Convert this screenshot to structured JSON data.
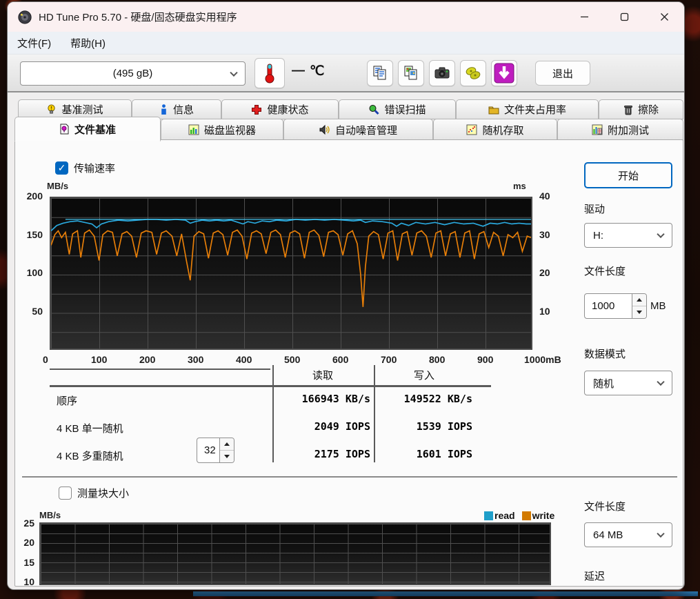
{
  "window": {
    "title": "HD Tune Pro 5.70 - 硬盘/固态硬盘实用程序"
  },
  "menu": {
    "file": "文件(F)",
    "help": "帮助(H)"
  },
  "toolbar": {
    "drive_value": "(495 gB)",
    "temp_value": "—",
    "temp_unit": "℃",
    "exit_label": "退出"
  },
  "tabs": {
    "row1": [
      "基准测试",
      "信息",
      "健康状态",
      "错误扫描",
      "文件夹占用率",
      "擦除"
    ],
    "row2": [
      "文件基准",
      "磁盘监视器",
      "自动噪音管理",
      "随机存取",
      "附加测试"
    ],
    "selected": "文件基准"
  },
  "benchmark": {
    "transfer_rate_label": "传输速率",
    "start_label": "开始",
    "drive_label": "驱动",
    "drive_value": "H:",
    "file_length_label": "文件长度",
    "file_length_value": "1000",
    "file_length_unit": "MB",
    "data_mode_label": "数据模式",
    "data_mode_value": "随机"
  },
  "results_table": {
    "col_read": "读取",
    "col_write": "写入",
    "rows": [
      {
        "label": "顺序",
        "read": "166943 KB/s",
        "write": "149522 KB/s"
      },
      {
        "label": "4 KB 单一随机",
        "read": "2049 IOPS",
        "write": "1539 IOPS"
      },
      {
        "label": "4 KB 多重随机",
        "queue_depth": "32",
        "read": "2175 IOPS",
        "write": "1601 IOPS"
      }
    ]
  },
  "block_section": {
    "checkbox_label": "测量块大小",
    "file_length_label": "文件长度",
    "file_length_value": "64 MB",
    "latency_label": "延迟"
  },
  "chart_data": [
    {
      "id": "transfer-rate",
      "type": "line",
      "title": "传输速率",
      "ylabel_left": "MB/s",
      "ylabel_right": "ms",
      "xlim": [
        0,
        1000
      ],
      "ylim_left": [
        0,
        200
      ],
      "ylim_right": [
        0,
        40
      ],
      "grid": true,
      "xticks": [
        "0",
        "100",
        "200",
        "300",
        "400",
        "500",
        "600",
        "700",
        "800",
        "900",
        "1000mB"
      ],
      "yticks_left": [
        200,
        150,
        100,
        50
      ],
      "yticks_right": [
        40,
        30,
        20,
        10
      ],
      "series": [
        {
          "name": "read",
          "color": "#2aa9de",
          "points": [
            [
              0,
              157
            ],
            [
              12,
              164
            ],
            [
              25,
              167
            ],
            [
              40,
              169
            ],
            [
              55,
              170
            ],
            [
              70,
              168
            ],
            [
              85,
              166
            ],
            [
              95,
              161
            ],
            [
              105,
              166
            ],
            [
              120,
              169
            ],
            [
              140,
              171
            ],
            [
              160,
              170
            ],
            [
              180,
              171
            ],
            [
              200,
              172
            ],
            [
              220,
              172
            ],
            [
              240,
              171
            ],
            [
              260,
              172
            ],
            [
              280,
              171
            ],
            [
              290,
              167
            ],
            [
              300,
              169
            ],
            [
              315,
              171
            ],
            [
              330,
              170
            ],
            [
              345,
              171
            ],
            [
              360,
              170
            ],
            [
              375,
              171
            ],
            [
              390,
              168
            ],
            [
              400,
              166
            ],
            [
              410,
              169
            ],
            [
              425,
              167
            ],
            [
              440,
              170
            ],
            [
              455,
              169
            ],
            [
              470,
              171
            ],
            [
              490,
              170
            ],
            [
              510,
              172
            ],
            [
              530,
              171
            ],
            [
              550,
              172
            ],
            [
              570,
              171
            ],
            [
              590,
              172
            ],
            [
              610,
              171
            ],
            [
              630,
              170
            ],
            [
              645,
              171
            ],
            [
              655,
              168
            ],
            [
              670,
              170
            ],
            [
              690,
              169
            ],
            [
              710,
              167
            ],
            [
              720,
              163
            ],
            [
              730,
              167
            ],
            [
              745,
              164
            ],
            [
              760,
              168
            ],
            [
              780,
              166
            ],
            [
              800,
              168
            ],
            [
              820,
              165
            ],
            [
              840,
              168
            ],
            [
              860,
              166
            ],
            [
              880,
              167
            ],
            [
              900,
              163
            ],
            [
              915,
              167
            ],
            [
              930,
              166
            ],
            [
              945,
              168
            ],
            [
              960,
              166
            ],
            [
              975,
              167
            ],
            [
              990,
              166
            ],
            [
              1000,
              166
            ]
          ]
        },
        {
          "name": "read-max",
          "color": "#45c6ef",
          "points": [
            [
              30,
              172
            ],
            [
              1000,
              172
            ]
          ]
        },
        {
          "name": "write",
          "color": "#e87f08",
          "points": [
            [
              0,
              138
            ],
            [
              8,
              152
            ],
            [
              15,
              157
            ],
            [
              22,
              148
            ],
            [
              30,
              155
            ],
            [
              38,
              126
            ],
            [
              45,
              153
            ],
            [
              55,
              157
            ],
            [
              62,
              122
            ],
            [
              70,
              154
            ],
            [
              80,
              158
            ],
            [
              90,
              150
            ],
            [
              100,
              118
            ],
            [
              108,
              152
            ],
            [
              118,
              157
            ],
            [
              128,
              155
            ],
            [
              138,
              124
            ],
            [
              148,
              153
            ],
            [
              158,
              156
            ],
            [
              168,
              150
            ],
            [
              178,
              122
            ],
            [
              188,
              154
            ],
            [
              198,
              157
            ],
            [
              210,
              155
            ],
            [
              220,
              126
            ],
            [
              230,
              154
            ],
            [
              240,
              157
            ],
            [
              252,
              150
            ],
            [
              262,
              124
            ],
            [
              272,
              153
            ],
            [
              282,
              118
            ],
            [
              290,
              92
            ],
            [
              298,
              150
            ],
            [
              308,
              156
            ],
            [
              318,
              153
            ],
            [
              328,
              121
            ],
            [
              338,
              154
            ],
            [
              348,
              157
            ],
            [
              358,
              152
            ],
            [
              368,
              125
            ],
            [
              378,
              155
            ],
            [
              388,
              158
            ],
            [
              398,
              150
            ],
            [
              408,
              120
            ],
            [
              418,
              154
            ],
            [
              428,
              157
            ],
            [
              438,
              153
            ],
            [
              448,
              127
            ],
            [
              458,
              155
            ],
            [
              468,
              158
            ],
            [
              478,
              152
            ],
            [
              488,
              122
            ],
            [
              498,
              154
            ],
            [
              508,
              157
            ],
            [
              518,
              153
            ],
            [
              528,
              121
            ],
            [
              538,
              155
            ],
            [
              548,
              158
            ],
            [
              558,
              151
            ],
            [
              568,
              123
            ],
            [
              578,
              155
            ],
            [
              588,
              157
            ],
            [
              598,
              152
            ],
            [
              608,
              125
            ],
            [
              618,
              153
            ],
            [
              628,
              157
            ],
            [
              638,
              140
            ],
            [
              645,
              100
            ],
            [
              650,
              57
            ],
            [
              655,
              110
            ],
            [
              662,
              150
            ],
            [
              672,
              156
            ],
            [
              682,
              152
            ],
            [
              692,
              120
            ],
            [
              702,
              154
            ],
            [
              712,
              157
            ],
            [
              722,
              118
            ],
            [
              732,
              153
            ],
            [
              742,
              156
            ],
            [
              752,
              125
            ],
            [
              762,
              154
            ],
            [
              772,
              157
            ],
            [
              782,
              150
            ],
            [
              792,
              122
            ],
            [
              802,
              154
            ],
            [
              812,
              157
            ],
            [
              822,
              124
            ],
            [
              832,
              153
            ],
            [
              842,
              156
            ],
            [
              852,
              122
            ],
            [
              862,
              154
            ],
            [
              872,
              157
            ],
            [
              882,
              120
            ],
            [
              892,
              153
            ],
            [
              902,
              156
            ],
            [
              912,
              135
            ],
            [
              922,
              155
            ],
            [
              932,
              150
            ],
            [
              942,
              124
            ],
            [
              952,
              152
            ],
            [
              962,
              148
            ],
            [
              972,
              155
            ],
            [
              982,
              130
            ],
            [
              992,
              150
            ],
            [
              1000,
              148
            ]
          ]
        }
      ]
    },
    {
      "id": "block-size",
      "type": "line",
      "ylabel": "MB/s",
      "yticks": [
        25,
        20,
        15,
        10
      ],
      "ylim": [
        9,
        25
      ],
      "grid": true,
      "legend": [
        {
          "label": "read",
          "color": "#1f9fca"
        },
        {
          "label": "write",
          "color": "#d27a00"
        }
      ],
      "series": []
    }
  ]
}
